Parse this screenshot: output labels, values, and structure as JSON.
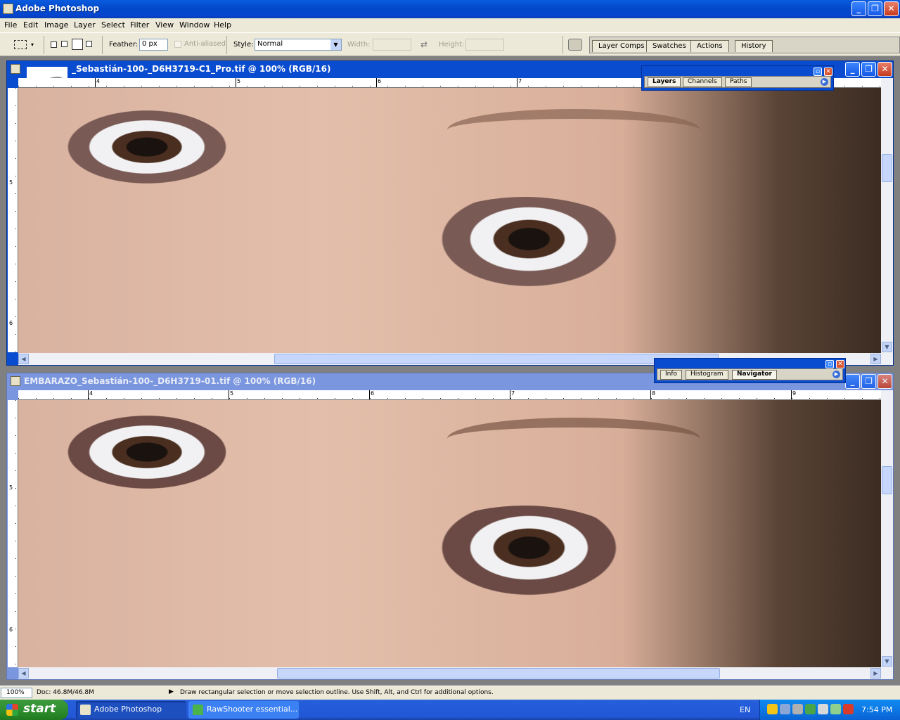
{
  "app": {
    "title": "Adobe Photoshop"
  },
  "menu": [
    "File",
    "Edit",
    "Image",
    "Layer",
    "Select",
    "Filter",
    "View",
    "Window",
    "Help"
  ],
  "options": {
    "feather_label": "Feather:",
    "feather_value": "0 px",
    "antialiased_label": "Anti-aliased",
    "style_label": "Style:",
    "style_value": "Normal",
    "width_label": "Width:",
    "height_label": "Height:"
  },
  "palette_well": {
    "tabs": [
      "Layer Comps",
      "Swatches",
      "Actions",
      "History"
    ]
  },
  "doc1": {
    "title": "_Sebastián-100-_D6H3719-C1_Pro.tif @ 100% (RGB/16)",
    "ruler_h_labels": [
      "4",
      "5",
      "6",
      "7"
    ],
    "ruler_v_labels": [
      "5",
      "6"
    ]
  },
  "doc2": {
    "title": "EMBARAZO_Sebastián-100-_D6H3719-01.tif @ 100% (RGB/16)",
    "ruler_h_labels": [
      "4",
      "5",
      "6",
      "7",
      "8",
      "9"
    ],
    "ruler_v_labels": [
      "5",
      "6"
    ]
  },
  "layers_palette": {
    "tabs": [
      "Layers",
      "Channels",
      "Paths"
    ],
    "active_tab": "Layers"
  },
  "navigator_palette": {
    "tabs": [
      "Info",
      "Histogram",
      "Navigator"
    ],
    "active_tab": "Navigator"
  },
  "status": {
    "zoom": "100%",
    "doc_size": "Doc: 46.8M/46.8M",
    "hint": "Draw rectangular selection or move selection outline.  Use Shift, Alt, and Ctrl for additional options."
  },
  "taskbar": {
    "start_label": "start",
    "tasks": [
      "Adobe Photoshop",
      "RawShooter essential..."
    ],
    "language": "EN",
    "clock": "7:54 PM"
  },
  "colors": {
    "title_blue": "#0a4ccf",
    "start_green": "#2f8e2f",
    "skin": "#e0baa6"
  }
}
